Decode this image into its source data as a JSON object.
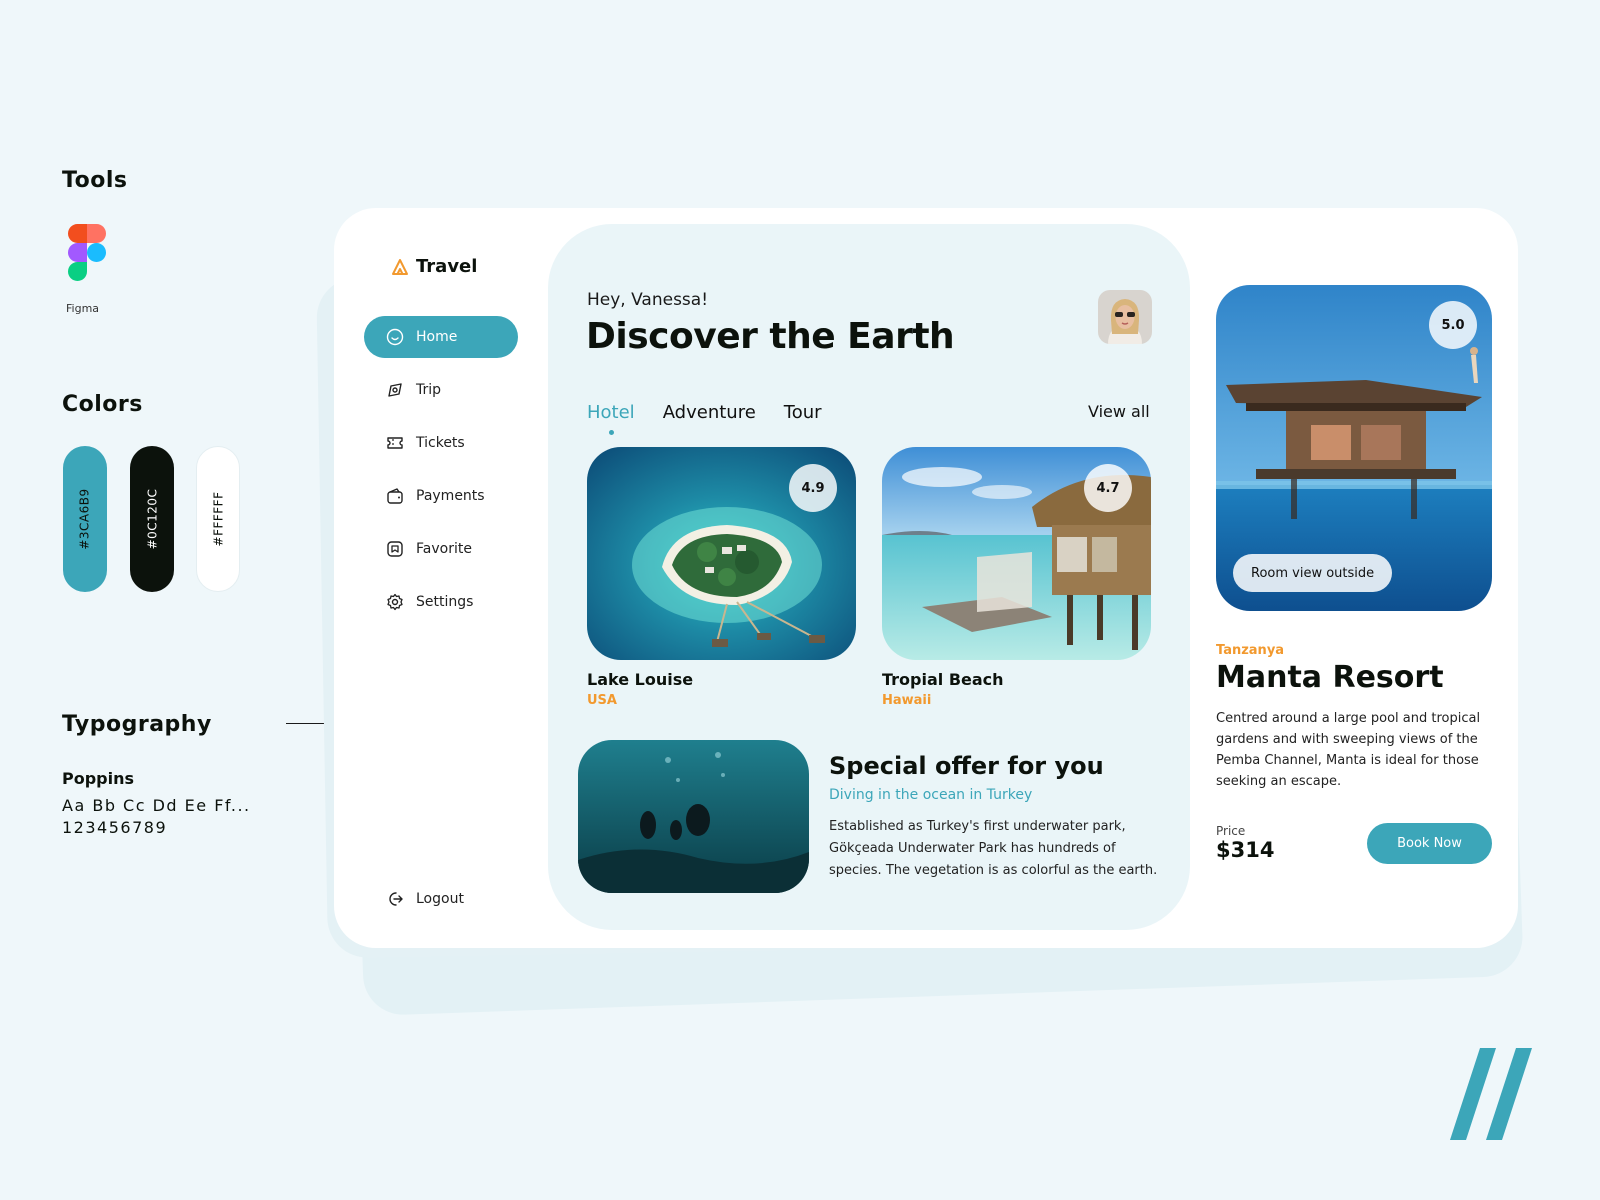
{
  "style_guide": {
    "tools_heading": "Tools",
    "figma_caption": "Figma",
    "colors_heading": "Colors",
    "colors": [
      {
        "label": "#3CA6B9",
        "value": "#3ca6b9"
      },
      {
        "label": "#0C120C",
        "value": "#0c120c"
      },
      {
        "label": "#FFFFFF",
        "value": "#ffffff"
      }
    ],
    "typography_heading": "Typography",
    "font_name": "Poppins",
    "sample_letters": "Aa Bb Cc Dd Ee Ff...",
    "sample_numbers": "123456789"
  },
  "app": {
    "brand": "Travel",
    "nav": [
      {
        "label": "Home",
        "icon": "home-icon",
        "active": true
      },
      {
        "label": "Trip",
        "icon": "compass-icon"
      },
      {
        "label": "Tickets",
        "icon": "ticket-icon"
      },
      {
        "label": "Payments",
        "icon": "wallet-icon"
      },
      {
        "label": "Favorite",
        "icon": "bookmark-icon"
      },
      {
        "label": "Settings",
        "icon": "gear-icon"
      }
    ],
    "logout": "Logout",
    "greeting": "Hey, Vanessa!",
    "headline": "Discover the Earth",
    "tabs": [
      {
        "label": "Hotel",
        "active": true
      },
      {
        "label": "Adventure"
      },
      {
        "label": "Tour"
      }
    ],
    "view_all": "View all",
    "places": [
      {
        "name": "Lake Louise",
        "country": "USA",
        "rating": "4.9"
      },
      {
        "name": "Tropial Beach",
        "country": "Hawaii",
        "rating": "4.7"
      }
    ],
    "offer": {
      "title": "Special offer for you",
      "subtitle": "Diving in the ocean in Turkey",
      "body": "Established as Turkey's first underwater park, Gökçeada Underwater Park  has hundreds of species. The vegetation is as colorful as the earth."
    },
    "resort": {
      "rating": "5.0",
      "image_label": "Room view outside",
      "region": "Tanzanya",
      "name": "Manta Resort",
      "description": "Centred around a large pool and tropical gardens and with sweeping views of the Pemba Channel, Manta is ideal for those seeking an escape.",
      "price_label": "Price",
      "price": "$314",
      "book_label": "Book Now"
    }
  },
  "theme": {
    "accent": "#3ca6b9",
    "dark": "#0c120c",
    "highlight": "#f2992e",
    "background": "#eff7fa"
  }
}
